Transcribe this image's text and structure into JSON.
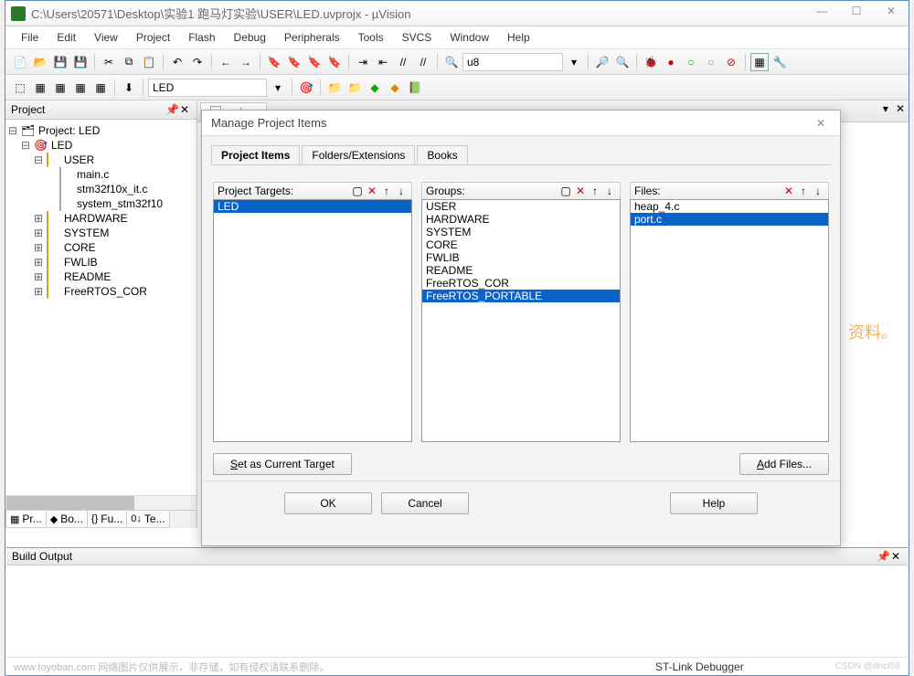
{
  "app": {
    "title": "C:\\Users\\20571\\Desktop\\实验1 跑马灯实验\\USER\\LED.uvprojx - µVision"
  },
  "menu": {
    "items": [
      "File",
      "Edit",
      "View",
      "Project",
      "Flash",
      "Debug",
      "Peripherals",
      "Tools",
      "SVCS",
      "Window",
      "Help"
    ]
  },
  "toolbar": {
    "search_value": "u8",
    "target_value": "LED"
  },
  "project_panel": {
    "title": "Project",
    "root": "Project: LED",
    "target": "LED",
    "groups": [
      {
        "name": "USER",
        "expanded": true,
        "files": [
          "main.c",
          "stm32f10x_it.c",
          "system_stm32f10"
        ]
      },
      {
        "name": "HARDWARE",
        "expanded": false
      },
      {
        "name": "SYSTEM",
        "expanded": false
      },
      {
        "name": "CORE",
        "expanded": false
      },
      {
        "name": "FWLIB",
        "expanded": false
      },
      {
        "name": "README",
        "expanded": false
      },
      {
        "name": "FreeRTOS_COR",
        "expanded": false
      }
    ],
    "tabs": [
      "Pr...",
      "Bo...",
      "Fu...",
      "Te..."
    ]
  },
  "editor": {
    "active_tab": "main.c",
    "side_text": "资料。"
  },
  "build_output": {
    "title": "Build Output"
  },
  "status": {
    "watermark": "www.toyoban.com  网络图片仅供展示，非存储，如有侵权请联系删除。",
    "debugger": "ST-Link Debugger",
    "csdn": "CSDN @dnct58"
  },
  "dialog": {
    "title": "Manage Project Items",
    "tabs": [
      "Project Items",
      "Folders/Extensions",
      "Books"
    ],
    "active_tab": 0,
    "col_targets": {
      "label": "Project Targets:",
      "items": [
        "LED"
      ],
      "selected": 0
    },
    "col_groups": {
      "label": "Groups:",
      "items": [
        "USER",
        "HARDWARE",
        "SYSTEM",
        "CORE",
        "FWLIB",
        "README",
        "FreeRTOS_COR",
        "FreeRTOS_PORTABLE"
      ],
      "selected": 7
    },
    "col_files": {
      "label": "Files:",
      "items": [
        "heap_4.c",
        "port.c"
      ],
      "selected": 1
    },
    "btn_set_target": "Set as Current Target",
    "btn_add_files": "Add Files...",
    "btn_ok": "OK",
    "btn_cancel": "Cancel",
    "btn_help": "Help"
  }
}
